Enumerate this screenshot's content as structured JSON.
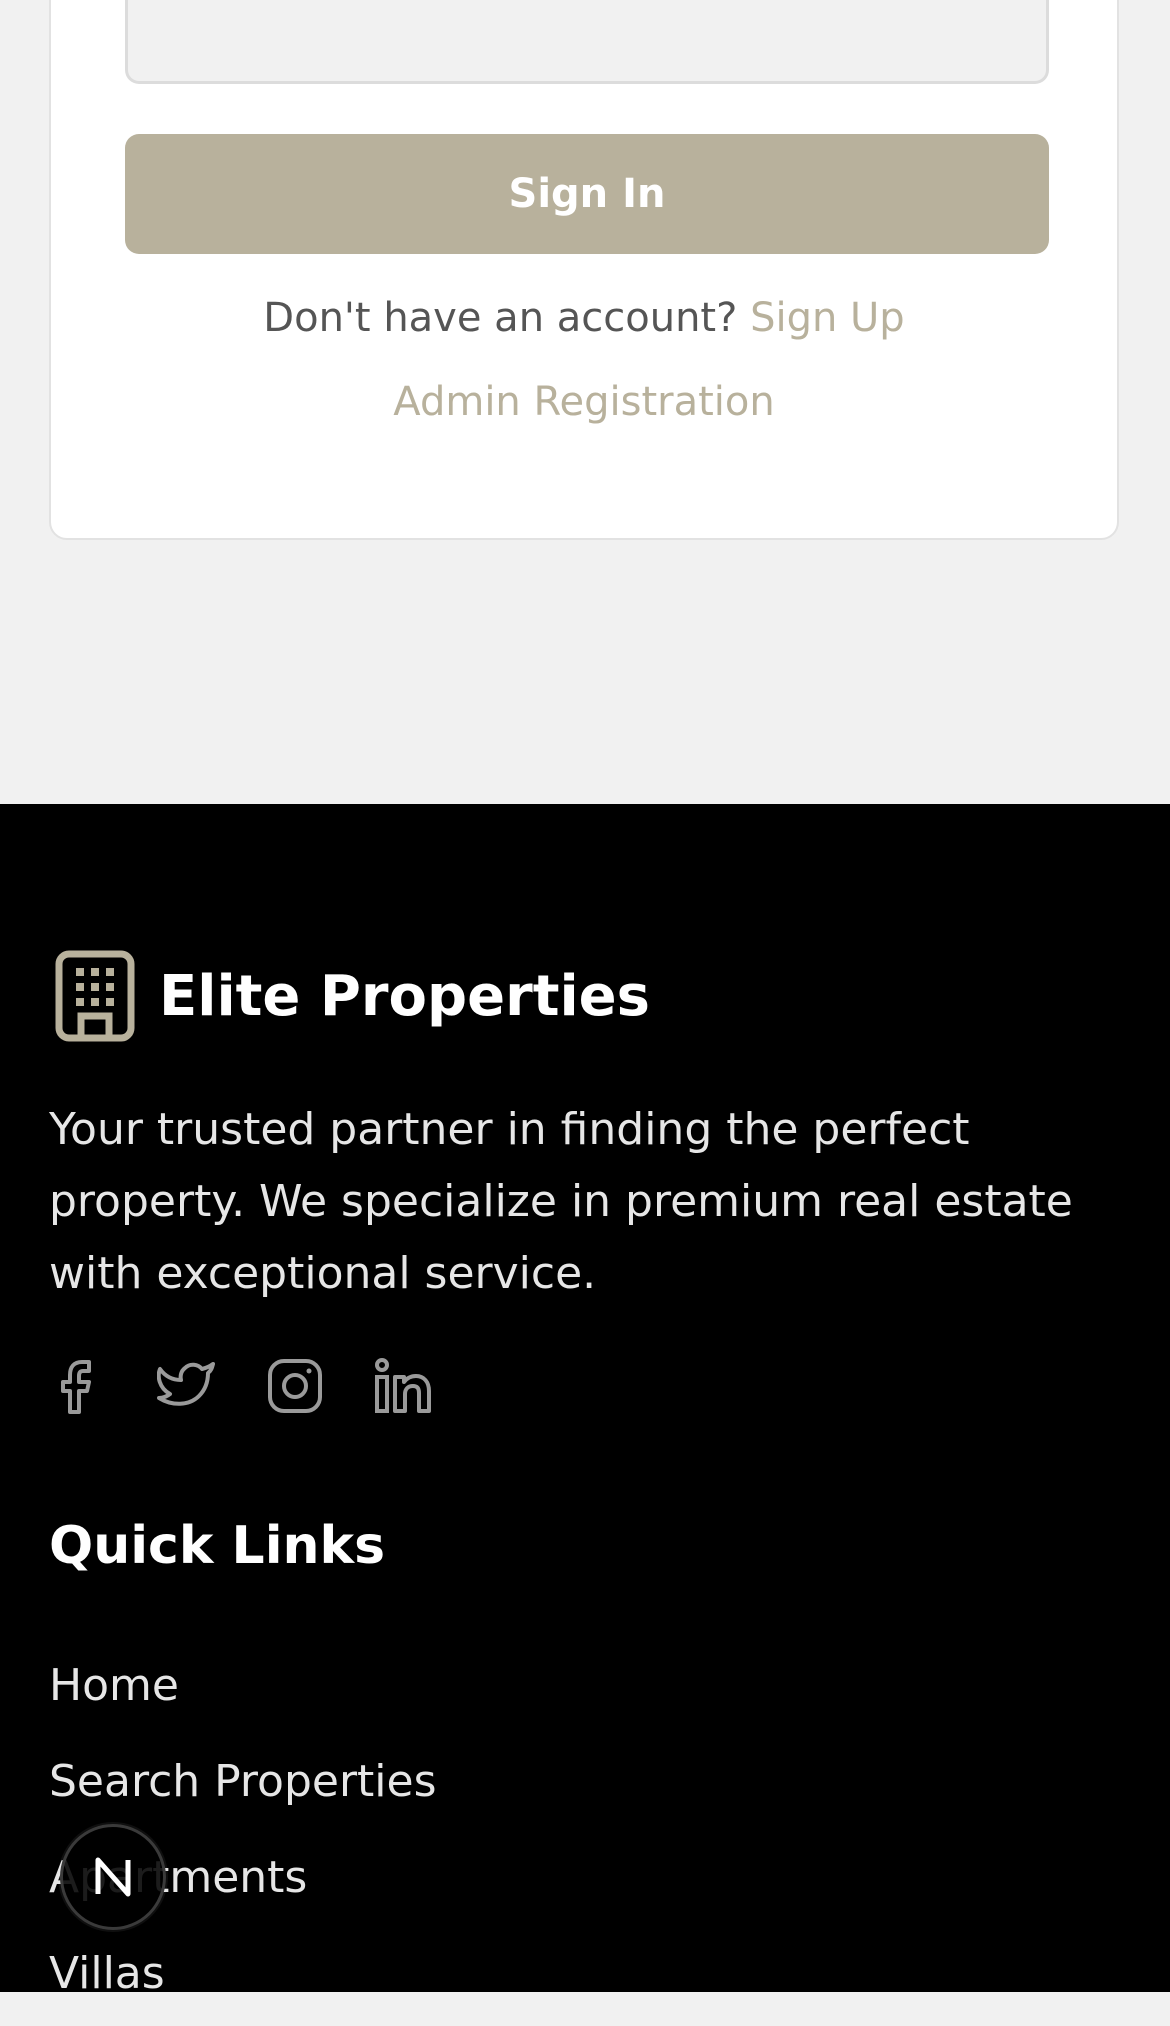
{
  "login": {
    "password_value": "",
    "sign_in_label": "Sign In",
    "no_account_text": "Don't have an account?",
    "sign_up_label": "Sign Up",
    "admin_registration_label": "Admin Registration"
  },
  "footer": {
    "brand_icon": "building-icon",
    "brand_name": "Elite Properties",
    "tagline": "Your trusted partner in finding the perfect property. We specialize in premium real estate with exceptional service.",
    "socials": [
      "facebook-icon",
      "twitter-icon",
      "instagram-icon",
      "linkedin-icon"
    ],
    "quick_links_title": "Quick Links",
    "quick_links": [
      "Home",
      "Search Properties",
      "Apartments",
      "Villas"
    ]
  },
  "overlay": {
    "badge_letter": "N"
  },
  "colors": {
    "accent": "#b8b19c",
    "footer_bg": "#000000",
    "page_bg": "#f1f1f1"
  }
}
